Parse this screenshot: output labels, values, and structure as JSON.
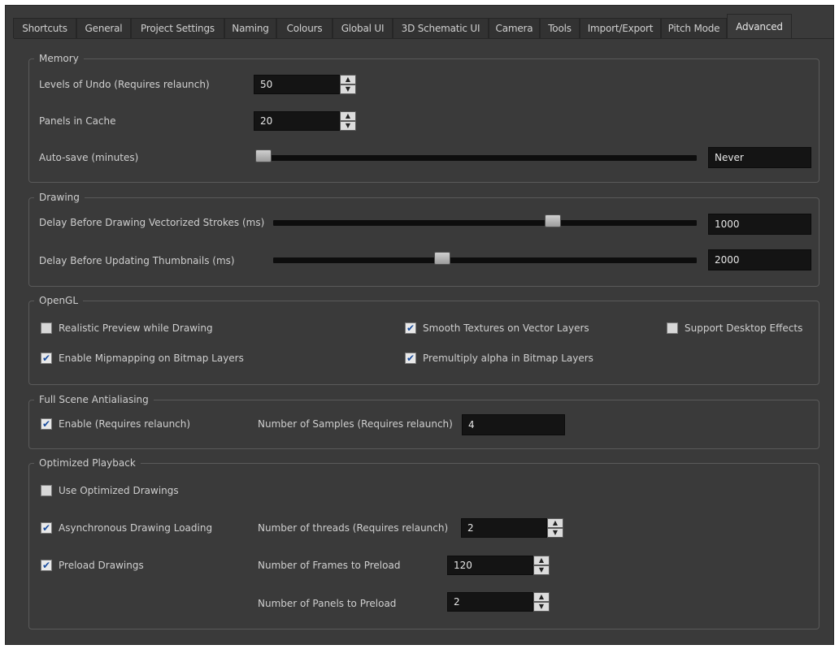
{
  "tabs": [
    {
      "label": "Shortcuts"
    },
    {
      "label": "General"
    },
    {
      "label": "Project Settings"
    },
    {
      "label": "Naming"
    },
    {
      "label": "Colours"
    },
    {
      "label": "Global UI"
    },
    {
      "label": "3D Schematic UI"
    },
    {
      "label": "Camera"
    },
    {
      "label": "Tools"
    },
    {
      "label": "Import/Export"
    },
    {
      "label": "Pitch Mode"
    },
    {
      "label": "Advanced"
    }
  ],
  "active_tab": "Advanced",
  "memory": {
    "title": "Memory",
    "undo_label": "Levels of Undo (Requires relaunch)",
    "undo_value": "50",
    "cache_label": "Panels in Cache",
    "cache_value": "20",
    "autosave_label": "Auto-save (minutes)",
    "autosave_value": "Never",
    "autosave_level": 0.0
  },
  "drawing": {
    "title": "Drawing",
    "delay_strokes_label": "Delay Before Drawing Vectorized Strokes (ms)",
    "delay_strokes_value": "1000",
    "delay_strokes_level": 0.66,
    "delay_thumbs_label": "Delay Before Updating Thumbnails (ms)",
    "delay_thumbs_value": "2000",
    "delay_thumbs_level": 0.4
  },
  "opengl": {
    "title": "OpenGL",
    "realistic_preview": {
      "label": "Realistic Preview while Drawing",
      "checked": false
    },
    "smooth_textures": {
      "label": "Smooth Textures on Vector Layers",
      "checked": true
    },
    "desktop_effects": {
      "label": "Support Desktop Effects",
      "checked": false
    },
    "mipmapping": {
      "label": "Enable Mipmapping on Bitmap Layers",
      "checked": true
    },
    "premultiply": {
      "label": "Premultiply alpha in Bitmap Layers",
      "checked": true
    }
  },
  "antialiasing": {
    "title": "Full Scene Antialiasing",
    "enable": {
      "label": "Enable (Requires relaunch)",
      "checked": true
    },
    "samples_label": "Number of Samples (Requires relaunch)",
    "samples_value": "4"
  },
  "playback": {
    "title": "Optimized Playback",
    "use_optimized": {
      "label": "Use Optimized Drawings",
      "checked": false
    },
    "async_loading": {
      "label": "Asynchronous Drawing Loading",
      "checked": true
    },
    "preload": {
      "label": "Preload Drawings",
      "checked": true
    },
    "threads_label": "Number of threads (Requires relaunch)",
    "threads_value": "2",
    "frames_label": "Number of Frames to Preload",
    "frames_value": "120",
    "panels_label": "Number of Panels to Preload",
    "panels_value": "2"
  },
  "icons": {
    "check": "✔",
    "up": "▲",
    "down": "▼"
  }
}
